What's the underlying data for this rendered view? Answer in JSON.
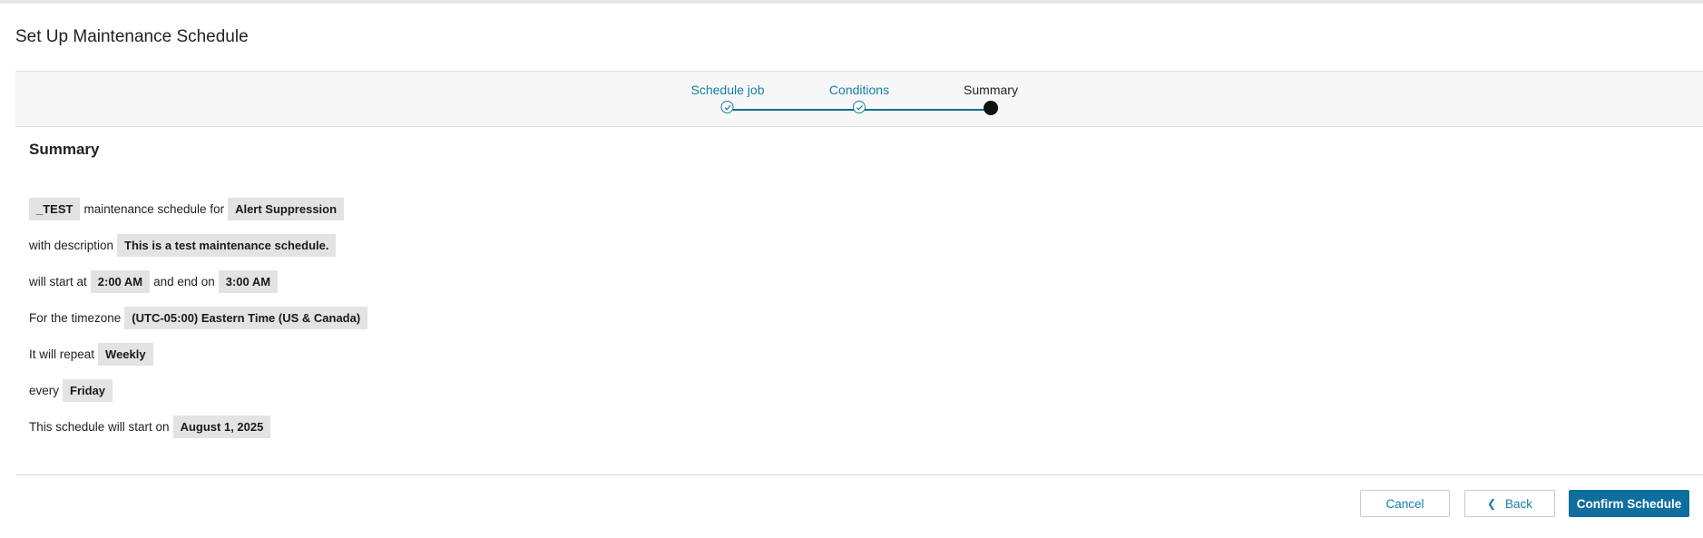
{
  "page": {
    "title": "Set Up Maintenance Schedule"
  },
  "stepper": {
    "steps": [
      {
        "label": "Schedule job",
        "state": "complete"
      },
      {
        "label": "Conditions",
        "state": "complete"
      },
      {
        "label": "Summary",
        "state": "active"
      }
    ]
  },
  "summary": {
    "heading": "Summary",
    "line1": {
      "chip1": "_TEST",
      "text": "maintenance schedule for",
      "chip2": "Alert Suppression"
    },
    "line2": {
      "text": "with description",
      "chip": "This is a test maintenance schedule."
    },
    "line3": {
      "text1": "will start at",
      "chip1": "2:00 AM",
      "text2": "and end on",
      "chip2": "3:00 AM"
    },
    "line4": {
      "text": "For the timezone",
      "chip": "(UTC-05:00) Eastern Time (US & Canada)"
    },
    "line5": {
      "text": "It will repeat",
      "chip": "Weekly"
    },
    "line6": {
      "text": "every",
      "chip": "Friday"
    },
    "line7": {
      "text": "This schedule will start on",
      "chip": "August 1, 2025"
    }
  },
  "footer": {
    "cancel_label": "Cancel",
    "back_label": "Back",
    "confirm_label": "Confirm Schedule"
  },
  "colors": {
    "accent": "#1480a8",
    "primary_button": "#0e6e9e",
    "chip_bg": "#e3e3e3"
  }
}
